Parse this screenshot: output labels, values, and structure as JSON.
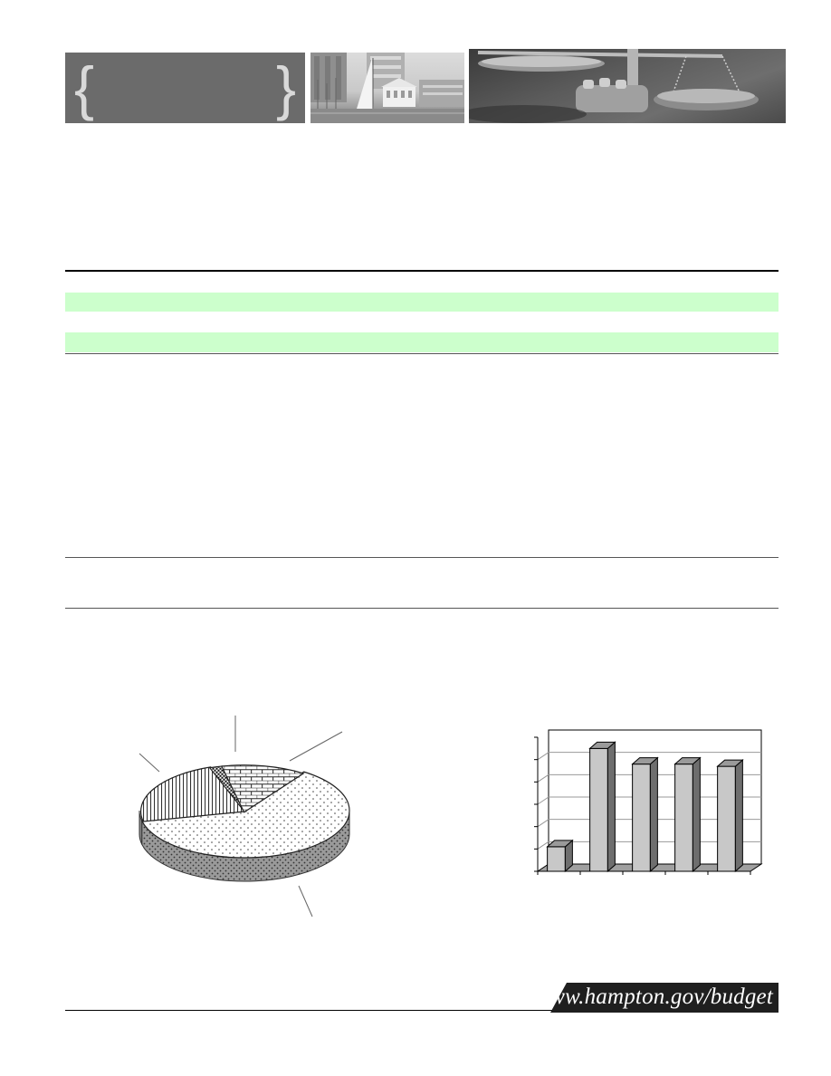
{
  "header": {
    "brace_open": "{",
    "brace_close": "}",
    "photo_left": "harbor-sailboat-photo",
    "photo_right": "scales-of-justice-photo"
  },
  "colors": {
    "section_bar": "#ccffcc",
    "banner_gray": "#6b6b6b",
    "footer_bg": "#1f1f1f"
  },
  "chart_data": [
    {
      "type": "pie",
      "title": "",
      "slices": [
        {
          "pattern": "dots",
          "share": 0.62
        },
        {
          "pattern": "vertical-lines",
          "share": 0.23
        },
        {
          "pattern": "checker",
          "share": 0.02
        },
        {
          "pattern": "bricks",
          "share": 0.13
        }
      ],
      "style": "3d"
    },
    {
      "type": "bar",
      "title": "",
      "categories": [
        "",
        "",
        "",
        "",
        ""
      ],
      "values": [
        1.1,
        5.5,
        4.8,
        4.8,
        4.7
      ],
      "ylim": [
        0,
        6
      ],
      "grid": true,
      "style": "3d"
    }
  ],
  "footer": {
    "url": "www.hampton.gov/budget"
  }
}
